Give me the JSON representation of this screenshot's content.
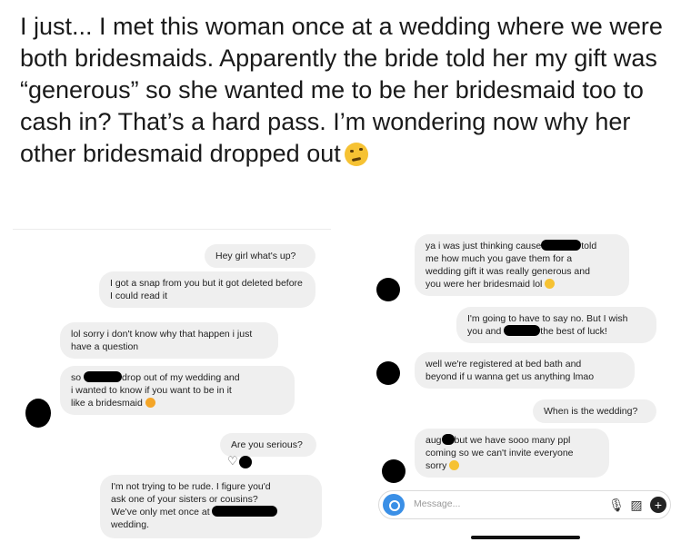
{
  "post": {
    "text": "I just... I met this woman once at a wedding where we were both bridesmaids. Apparently the bride told her my gift was “generous” so she wanted me to be her bridesmaid too to cash in? That’s a hard pass. I’m wondering now why her other bridesmaid dropped out",
    "emoji": "thinking-face-emoji"
  },
  "left_chat": {
    "messages": [
      {
        "sender": "me",
        "text": "Hey girl what's up?"
      },
      {
        "sender": "me",
        "text": "I got a snap from you but it got deleted before I could read it"
      },
      {
        "sender": "them",
        "text": "lol sorry i don't know why that happen i just have a question"
      },
      {
        "sender": "them",
        "prefix": "so",
        "text_a": "drop out of my wedding and",
        "text_b": "i wanted to know if you want to be in it",
        "text_c": "like a bridesmaid"
      },
      {
        "sender": "me",
        "text": "Are you serious?"
      },
      {
        "sender": "me",
        "line1": "I'm not trying to be rude. I figure you'd",
        "line2": "ask one of your sisters or cousins?",
        "line3": "We've only met once at",
        "line4": "wedding."
      }
    ]
  },
  "right_chat": {
    "messages": [
      {
        "sender": "them",
        "line1a": "ya i was just thinking cause",
        "line1b": "told",
        "line2": "me how much you gave them for a",
        "line3": "wedding gift it was really generous and",
        "line4": "you were her bridesmaid lol"
      },
      {
        "sender": "me",
        "line1": "I'm going to have to say no. But I wish",
        "line2a": "you and",
        "line2b": "the best of luck!"
      },
      {
        "sender": "them",
        "line1": "well we're registered at bed bath and",
        "line2": "beyond if u wanna get us anything lmao"
      },
      {
        "sender": "me",
        "text": "When is the wedding?"
      },
      {
        "sender": "them",
        "line1a": "aug",
        "line1b": "but we have sooo many ppl",
        "line2": "coming so we can't invite everyone",
        "line3": "sorry"
      }
    ],
    "composer": {
      "placeholder": "Message...",
      "icons": [
        "camera-icon",
        "microphone-icon",
        "image-icon",
        "plus-icon"
      ]
    }
  },
  "colors": {
    "bubble": "#efefef",
    "text": "#1a1a1a",
    "camera": "#3a8fe6"
  }
}
